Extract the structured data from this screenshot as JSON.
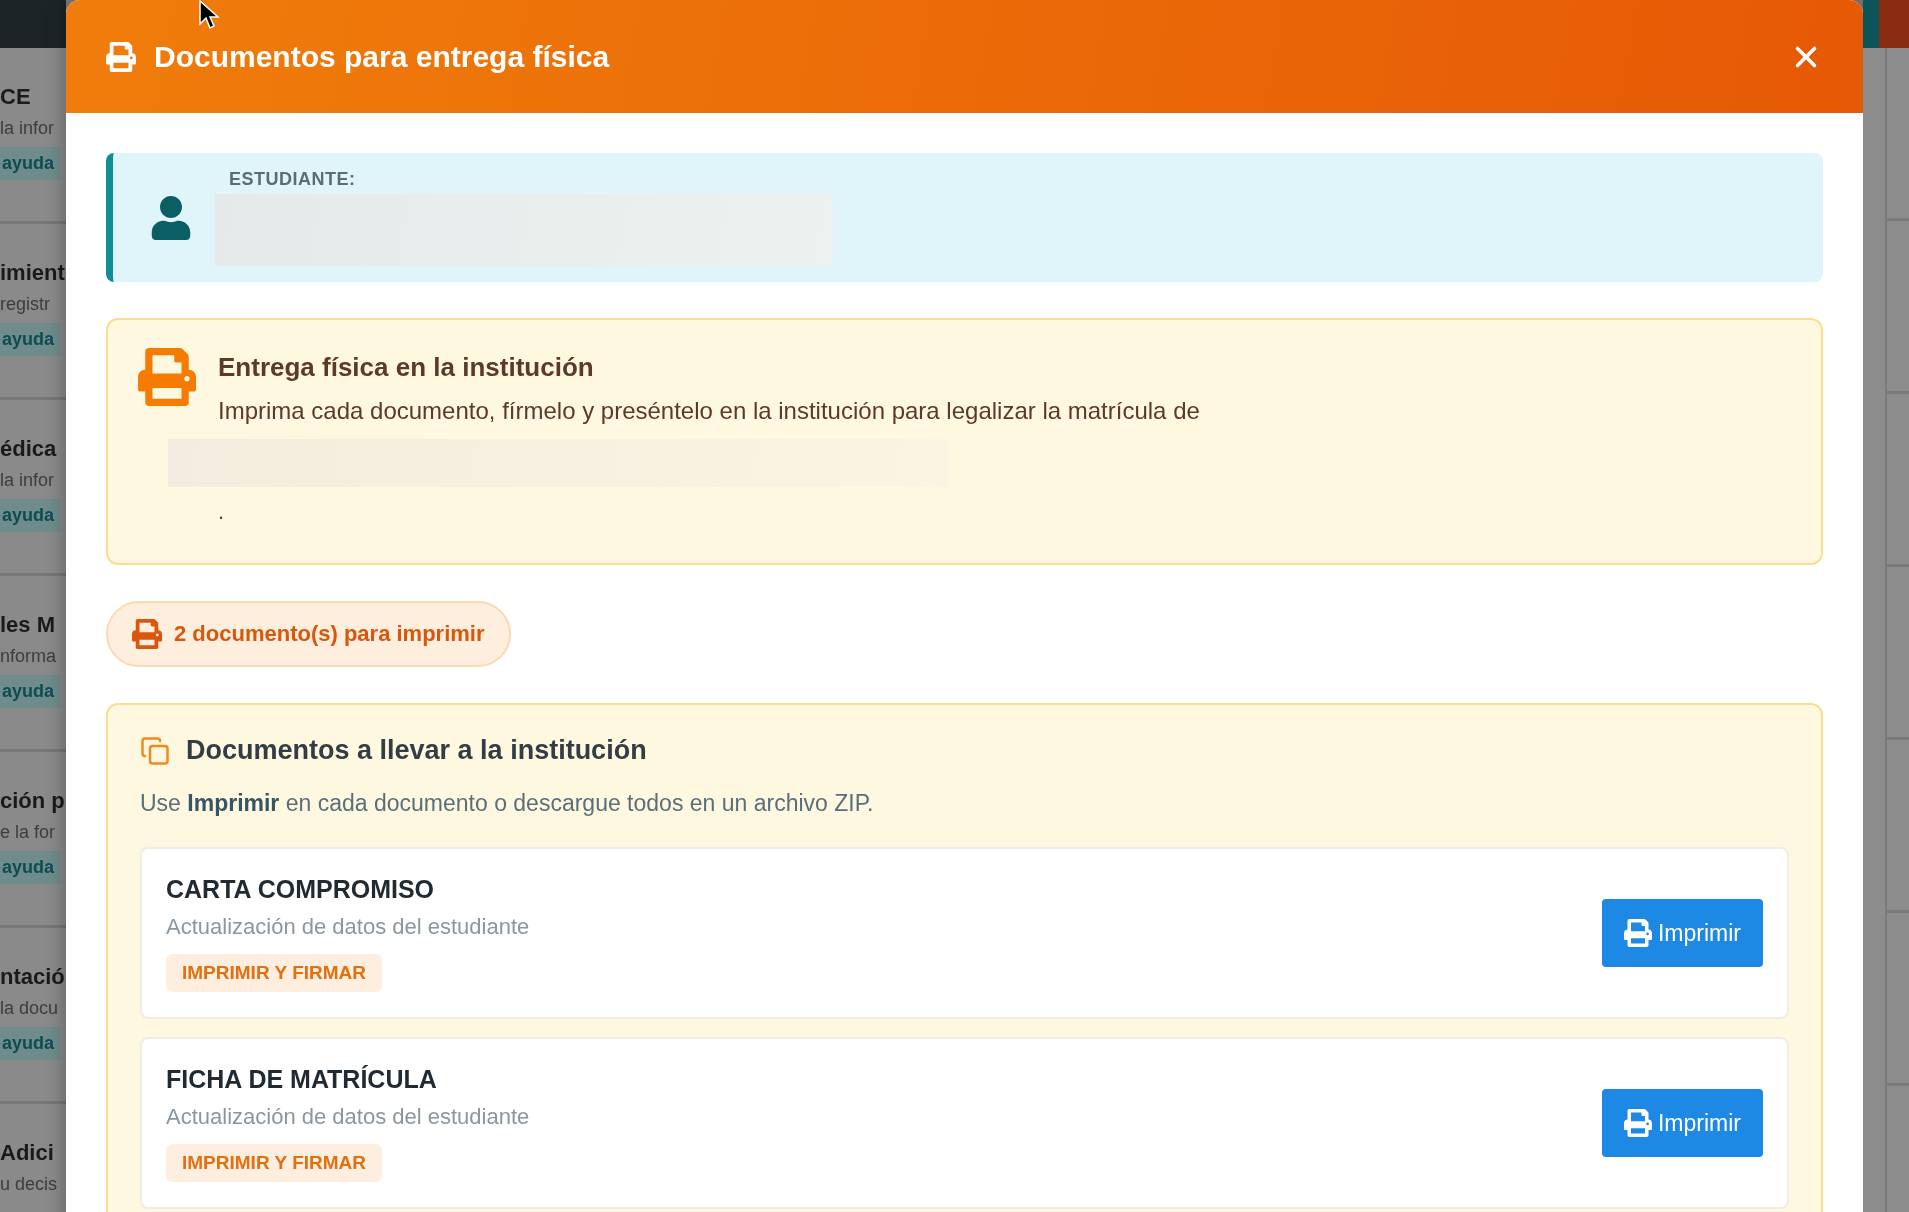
{
  "background": {
    "cards": [
      {
        "title": "CE",
        "text": "la infor",
        "button": "ayuda"
      },
      {
        "title": "imient",
        "text": "registr",
        "button": "ayuda"
      },
      {
        "title": "édica",
        "text": "la infor",
        "button": "ayuda"
      },
      {
        "title": "les M",
        "text": "nforma",
        "button": "ayuda"
      },
      {
        "title": "ción p",
        "text": "e la for",
        "button": "ayuda"
      },
      {
        "title": "ntació",
        "text": "la docu",
        "button": "ayuda"
      },
      {
        "title": "Adici",
        "text": "u decis"
      }
    ]
  },
  "dialog": {
    "title": "Documentos para entrega física"
  },
  "student": {
    "label": "ESTUDIANTE:"
  },
  "notice": {
    "title": "Entrega física en la institución",
    "text": "Imprima cada documento, fírmelo y preséntelo en la institución para legalizar la matrícula de",
    "trailing": "."
  },
  "count_badge": "2 documento(s) para imprimir",
  "documents": {
    "title": "Documentos a llevar a la institución",
    "hint": "Use **Imprimir** en cada documento o descargue todos en un archivo ZIP.",
    "items": [
      {
        "name": "CARTA COMPROMISO",
        "description": "Actualización de datos del estudiante",
        "tag": "IMPRIMIR Y FIRMAR",
        "action": "Imprimir"
      },
      {
        "name": "FICHA DE MATRÍCULA",
        "description": "Actualización de datos del estudiante",
        "tag": "IMPRIMIR Y FIRMAR",
        "action": "Imprimir"
      }
    ]
  }
}
